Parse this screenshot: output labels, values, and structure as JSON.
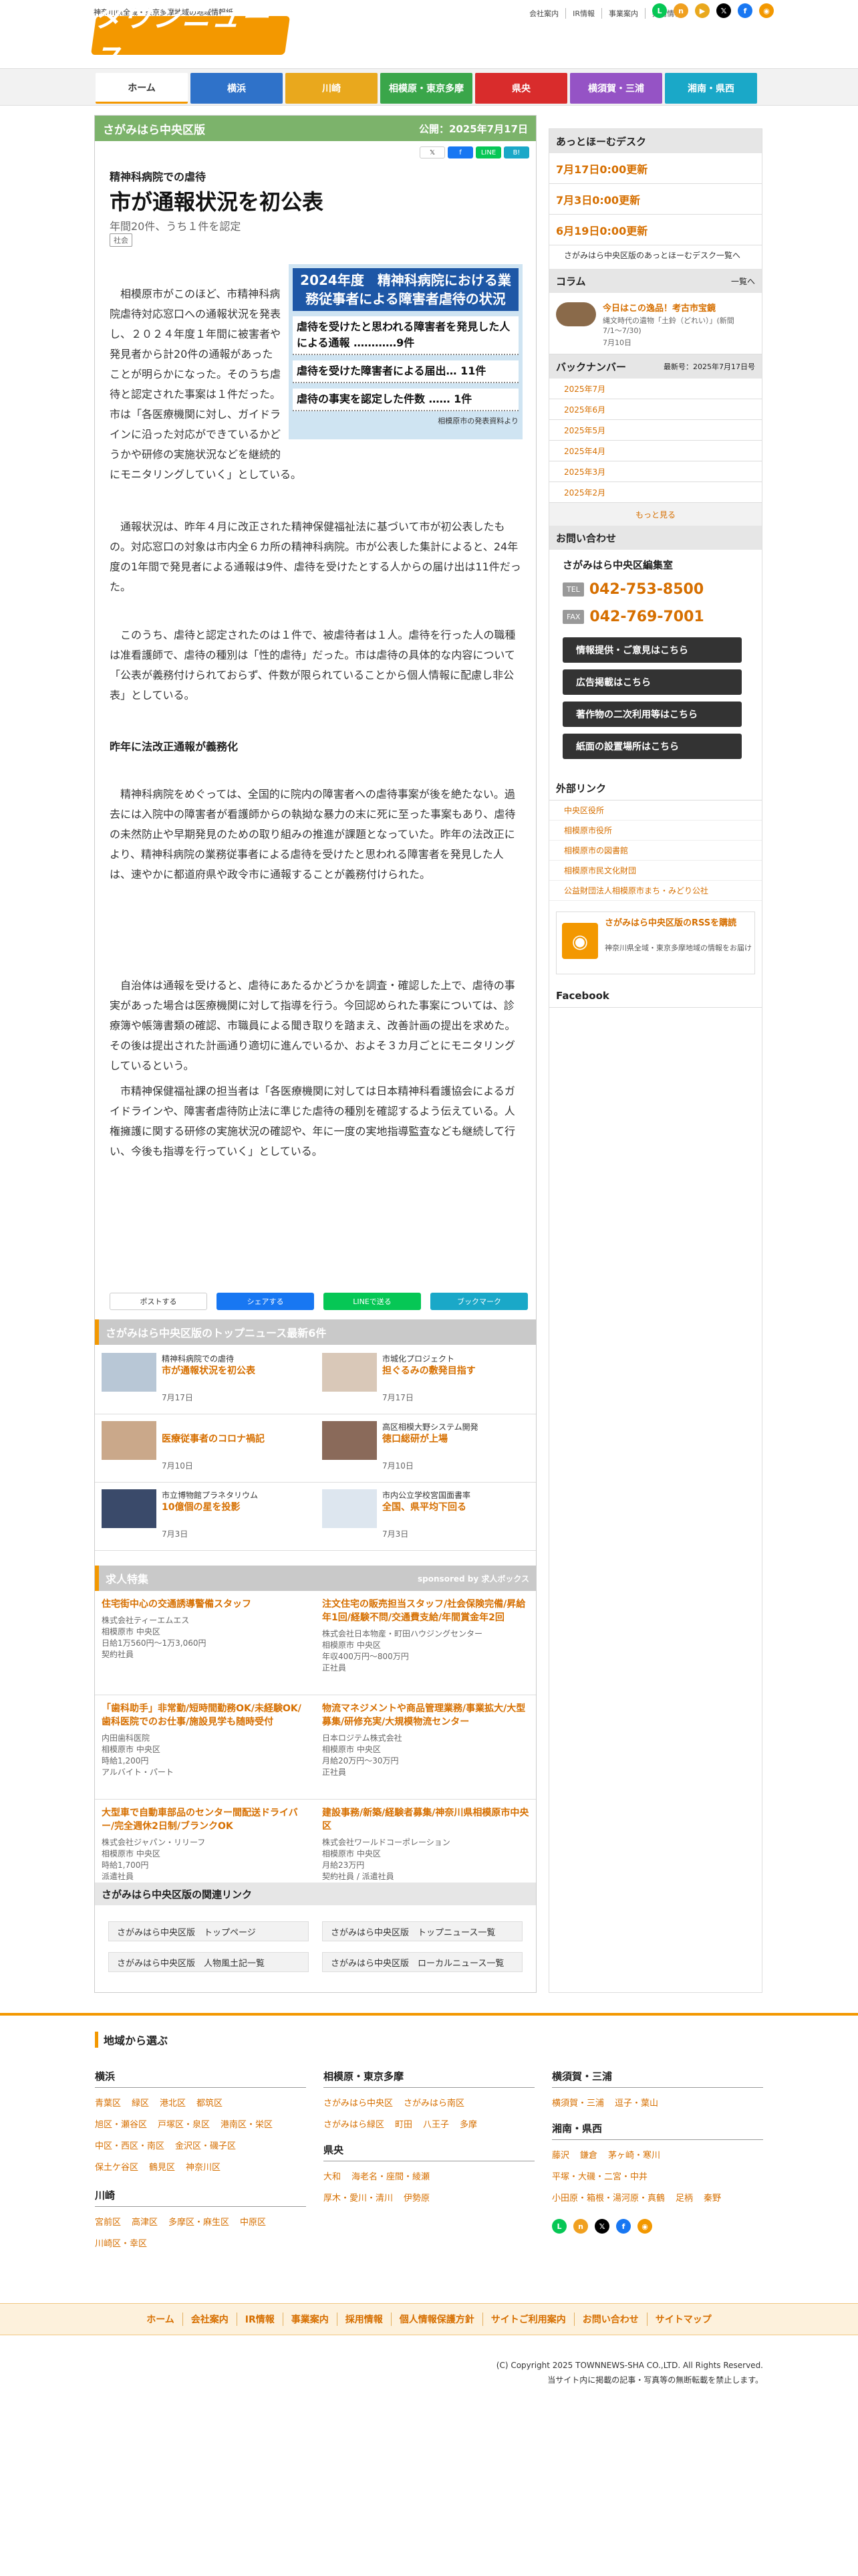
{
  "header": {
    "tagline": "神奈川県全域・東京多摩地域の地域情報紙",
    "logo_text": "タウンニュース",
    "top_links": [
      "会社案内",
      "IR情報",
      "事業案内",
      "採用情報"
    ],
    "social_icons": [
      "line-icon",
      "note-icon",
      "youtube-icon",
      "x-icon",
      "facebook-icon",
      "rss-icon"
    ]
  },
  "nav": {
    "tabs": [
      {
        "label": "ホーム",
        "color": "#ffffff"
      },
      {
        "label": "横浜",
        "color": "#2f72c9"
      },
      {
        "label": "川崎",
        "color": "#e9a81d"
      },
      {
        "label": "相模原・東京多摩",
        "color": "#3aa64a"
      },
      {
        "label": "県央",
        "color": "#d92c2c"
      },
      {
        "label": "横須賀・三浦",
        "color": "#9553c5"
      },
      {
        "label": "湘南・県西",
        "color": "#1aa8c8"
      }
    ]
  },
  "article": {
    "edition": "さがみはら中央区版",
    "published": "公開：2025年7月17日",
    "share_top": [
      "𝕏",
      "f",
      "LINE",
      "B!"
    ],
    "kicker": "精神科病院での虐待",
    "title": "市が通報状況を初公表",
    "subtitle": "年間20件、うち１件を認定",
    "tag": "社会",
    "figure": {
      "heading": "2024年度　精神科病院における業務従事者による障害者虐待の状況",
      "rows": [
        "虐待を受けたと思われる障害者を発見した人による通報 …………9件",
        "虐待を受けた障害者による届出… 11件",
        "虐待の事実を認定した件数 …… 1件"
      ],
      "note": "相模原市の発表資料より"
    },
    "p1": "相模原市がこのほど、市精神科病院虐待対応窓口への通報状況を発表し、２０２４年度１年間に被害者や発見者から計20件の通報があったことが明らかになった。そのうち虐待と認定された事案は１件だった。市は「各医療機関に対し、ガイドラインに沿った対応ができているかどうかや研修の実施状況などを継続的にモニタリングしていく」としている。",
    "p2": "通報状況は、昨年４月に改正された精神保健福祉法に基づいて市が初公表したもの。対応窓口の対象は市内全６カ所の精神科病院。市が公表した集計によると、24年度の1年間で発見者による通報は9件、虐待を受けたとする人からの届け出は11件だった。",
    "p3": "このうち、虐待と認定されたのは１件で、被虐待者は１人。虐待を行った人の職種は准看護師で、虐待の種別は「性的虐待」だった。市は虐待の具体的な内容について「公表が義務付けられておらず、件数が限られていることから個人情報に配慮し非公表」としている。",
    "midhead": "昨年に法改正通報が義務化",
    "p4": "精神科病院をめぐっては、全国的に院内の障害者への虐待事案が後を絶たない。過去には入院中の障害者が看護師からの執拗な暴力の末に死に至った事案もあり、虐待の未然防止や早期発見のための取り組みの推進が課題となっていた。昨年の法改正により、精神科病院の業務従事者による虐待を受けたと思われる障害者を発見した人は、速やかに都道府県や政令市に通報することが義務付けられた。",
    "p5": "自治体は通報を受けると、虐待にあたるかどうかを調査・確認した上で、虐待の事実があった場合は医療機関に対して指導を行う。今回認められた事案については、診療簿や帳簿書類の確認、市職員による聞き取りを踏まえ、改善計画の提出を求めた。その後は提出された計画通り適切に進んでいるか、およそ３カ月ごとにモニタリングしているという。",
    "p6": "市精神保健福祉課の担当者は「各医療機関に対しては日本精神科看護協会によるガイドラインや、障害者虐待防止法に準じた虐待の種別を確認するよう伝えている。人権擁護に関する研修の実施状況の確認や、年に一度の実地指導監査なども継続して行い、今後も指導を行っていく」としている。",
    "share_bottom": [
      "ポストする",
      "シェアする",
      "LINEで送る",
      "ブックマーク"
    ]
  },
  "top_news": {
    "heading": "さがみはら中央区版のトップニュース最新6件",
    "items": [
      {
        "kicker": "精神科病院での虐待",
        "title": "市が通報状況を初公表",
        "date": "7月17日"
      },
      {
        "kicker": "市城化プロジェクト",
        "title": "担ぐるみの敷発目指す",
        "date": "7月17日"
      },
      {
        "kicker": "",
        "title": "医療従事者のコロナ禍記",
        "date": "7月10日"
      },
      {
        "kicker": "高区相模大野システム開発",
        "title": "徳口総研が上場",
        "date": "7月10日"
      },
      {
        "kicker": "市立博物館プラネタリウム",
        "title": "10億個の星を投影",
        "date": "7月3日"
      },
      {
        "kicker": "市内公立学校宮国面書率",
        "title": "全国、県平均下回る",
        "date": "7月3日"
      }
    ]
  },
  "jobs": {
    "heading": "求人特集",
    "sponsor": "sponsored by 求人ボックス",
    "items": [
      {
        "title": "住宅街中心の交通誘導警備スタッフ",
        "company": "株式会社ティーエムエス",
        "place": "相模原市 中央区",
        "pay": "日給1万560円〜1万3,060円",
        "type": "契約社員"
      },
      {
        "title": "注文住宅の販売担当スタッフ/社会保険完備/昇給年1回/経験不問/交通費支給/年間賞金年2回",
        "company": "株式会社日本物産・町田ハウジングセンター",
        "place": "相模原市 中央区",
        "pay": "年収400万円〜800万円",
        "type": "正社員"
      },
      {
        "title": "「歯科助手」非常勤/短時間勤務OK/未経験OK/歯科医院でのお仕事/施設見学も随時受付",
        "company": "内田歯科医院",
        "place": "相模原市 中央区",
        "pay": "時給1,200円",
        "type": "アルバイト・パート"
      },
      {
        "title": "物流マネジメントや商品管理業務/事業拡大/大型募集/研修充実/大規模物流センター",
        "company": "日本ロジテム株式会社",
        "place": "相模原市 中央区",
        "pay": "月給20万円〜30万円",
        "type": "正社員"
      },
      {
        "title": "大型車で自動車部品のセンター間配送ドライバー/完全週休2日制/ブランクOK",
        "company": "株式会社ジャパン・リリーフ",
        "place": "相模原市 中央区",
        "pay": "時給1,700円",
        "type": "派遣社員"
      },
      {
        "title": "建設事務/新築/経験者募集/神奈川県相模原市中央区",
        "company": "株式会社ワールドコーポレーション",
        "place": "相模原市 中央区",
        "pay": "月給23万円",
        "type": "契約社員 / 派遣社員"
      }
    ]
  },
  "related": {
    "heading": "さがみはら中央区版の関連リンク",
    "links": [
      "さがみはら中央区版　トップページ",
      "さがみはら中央区版　トップニュース一覧",
      "さがみはら中央区版　人物風土記一覧",
      "さがみはら中央区版　ローカルニュース一覧"
    ]
  },
  "sidebar": {
    "desk_heading": "あっとほーむデスク",
    "desk_dates": [
      "7月17日0:00更新",
      "7月3日0:00更新",
      "6月19日0:00更新"
    ],
    "desk_more": "さがみはら中央区版のあっとほーむデスク一覧へ",
    "column_heading": "コラム",
    "column_more": "一覧へ",
    "column_title": "今日はこの逸品！考古市宝鏡",
    "column_desc": "縄文時代の遺物「土鈴（どれい）」(新間 7/1〜7/30)",
    "column_date": "7月10日",
    "back_heading": "バックナンバー",
    "back_latest": "最新号：2025年7月17日号",
    "back_items": [
      "2025年7月",
      "2025年6月",
      "2025年5月",
      "2025年4月",
      "2025年3月",
      "2025年2月"
    ],
    "back_more": "もっと見る",
    "contact_heading": "お問い合わせ",
    "contact_name": "さがみはら中央区編集室",
    "tel_label": "TEL",
    "tel": "042-753-8500",
    "fax_label": "FAX",
    "fax": "042-769-7001",
    "buttons": [
      "情報提供・ご意見はこちら",
      "広告掲載はこちら",
      "著作物の二次利用等はこちら",
      "紙面の設置場所はこちら"
    ],
    "ext_heading": "外部リンク",
    "ext_links": [
      "中央区役所",
      "相模原市役所",
      "相模原市の図書館",
      "相模原市民文化財団",
      "公益財団法人相模原市まち・みどり公社"
    ],
    "rss_title": "さがみはら中央区版のRSSを購読",
    "rss_desc": "神奈川県全域・東京多摩地域の情報をお届け",
    "facebook_heading": "Facebook"
  },
  "footer": {
    "heading": "地域から選ぶ",
    "regions": [
      {
        "name": "横浜",
        "areas": [
          "青葉区",
          "緑区",
          "港北区",
          "都筑区",
          "旭区・瀬谷区",
          "戸塚区・泉区",
          "港南区・栄区",
          "中区・西区・南区",
          "金沢区・磯子区",
          "保土ケ谷区",
          "鶴見区",
          "神奈川区"
        ]
      },
      {
        "name": "川崎",
        "areas": [
          "宮前区",
          "高津区",
          "多摩区・麻生区",
          "中原区",
          "川崎区・幸区"
        ]
      },
      {
        "name": "相模原・東京多摩",
        "areas": [
          "さがみはら中央区",
          "さがみはら南区",
          "さがみはら緑区",
          "町田",
          "八王子",
          "多摩"
        ]
      },
      {
        "name": "県央",
        "areas": [
          "大和",
          "海老名・座間・綾瀬",
          "厚木・愛川・清川",
          "伊勢原"
        ]
      },
      {
        "name": "横須賀・三浦",
        "areas": [
          "横須賀・三浦",
          "逗子・葉山"
        ]
      },
      {
        "name": "湘南・県西",
        "areas": [
          "藤沢",
          "鎌倉",
          "茅ヶ崎・寒川",
          "平塚・大磯・二宮・中井",
          "小田原・箱根・湯河原・真鶴",
          "足柄",
          "秦野"
        ]
      }
    ],
    "nav": [
      "ホーム",
      "会社案内",
      "IR情報",
      "事業案内",
      "採用情報",
      "個人情報保護方針",
      "サイトご利用案内",
      "お問い合わせ",
      "サイトマップ"
    ],
    "copyright": "(C) Copyright 2025 TOWNNEWS-SHA CO.,LTD. All Rights Reserved.",
    "notice": "当サイト内に掲載の記事・写真等の無断転載を禁止します。"
  }
}
